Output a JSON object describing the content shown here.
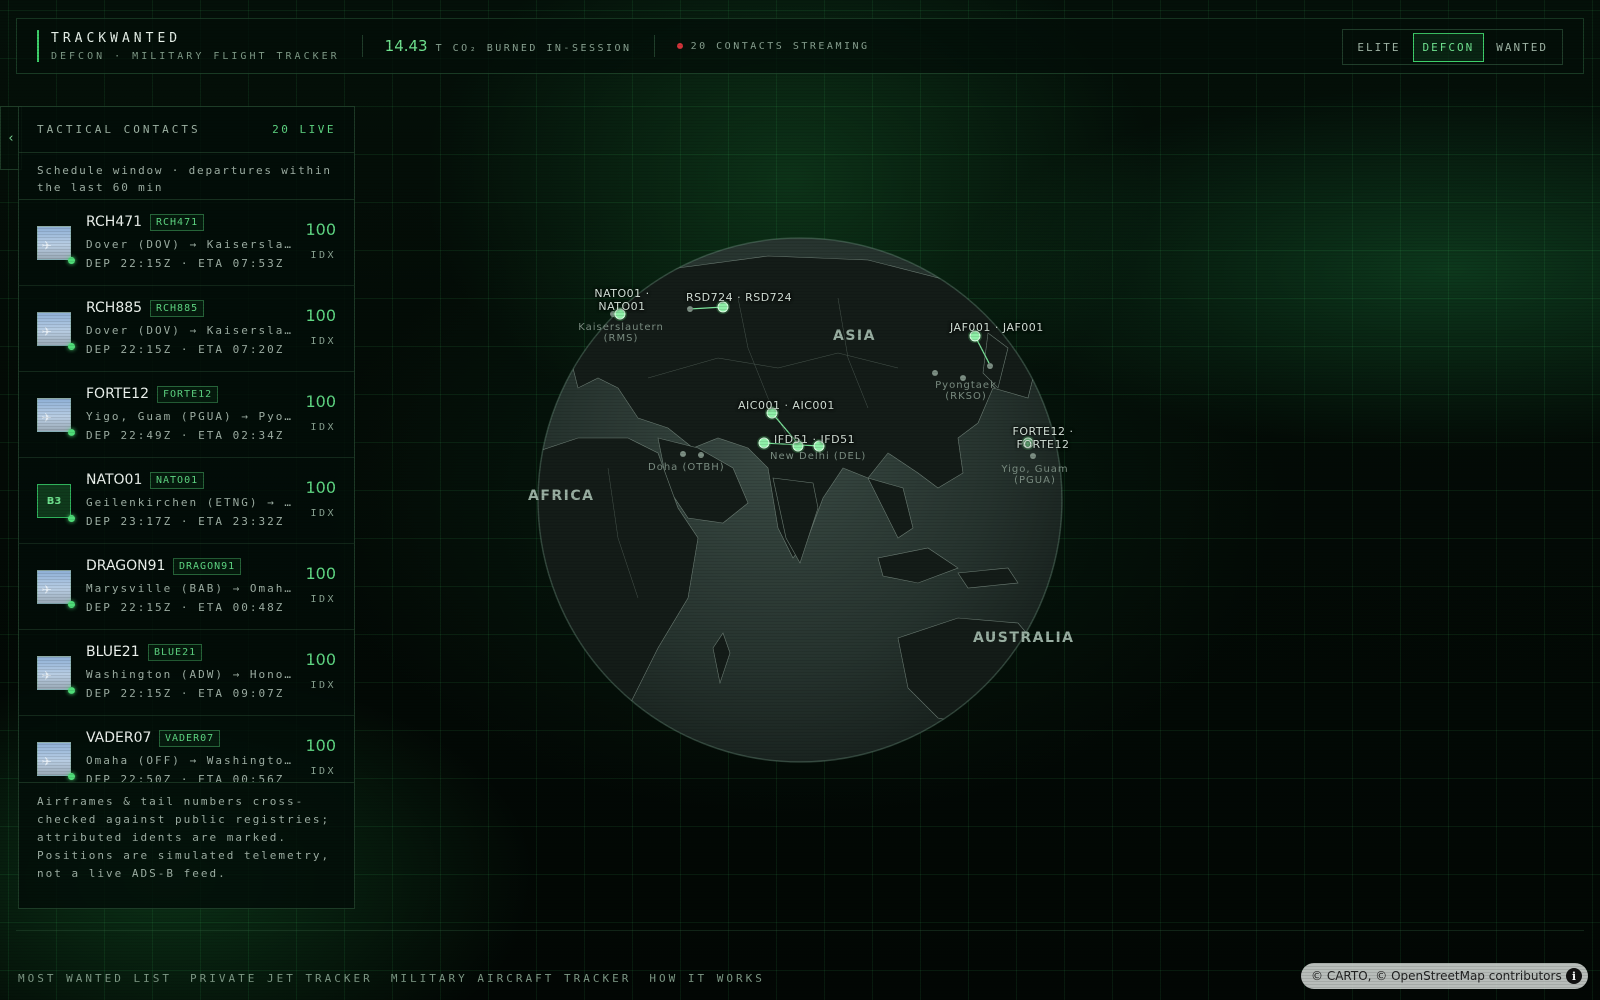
{
  "header": {
    "brand_title": "TRACKWANTED",
    "brand_subtitle": "DEFCON · MILITARY FLIGHT TRACKER",
    "co2_value": "14.43",
    "co2_label": "T CO₂ BURNED IN-SESSION",
    "contacts_label": "20 CONTACTS STREAMING",
    "modes": [
      "ELITE",
      "DEFCON",
      "WANTED"
    ],
    "active_mode": "DEFCON"
  },
  "colors": {
    "accent": "#3ecf6a",
    "live": "#4fdc78",
    "alert": "#d3343a",
    "background": "#020805"
  },
  "sidebar": {
    "collapse_icon": "chevron-left-icon",
    "title": "TACTICAL CONTACTS",
    "live_count": "20 LIVE",
    "window_note": "Schedule window · departures within the last 60 min",
    "items": [
      {
        "callsign": "RCH471",
        "tag": "RCH471",
        "route": "Dover (DOV) → Kaiserslautern (RMS)",
        "times": "DEP 22:15Z · ETA 07:53Z",
        "score": "100",
        "score_label": "IDX",
        "thumb": "photo"
      },
      {
        "callsign": "RCH885",
        "tag": "RCH885",
        "route": "Dover (DOV) → Kaiserslautern (RMS)",
        "times": "DEP 22:15Z · ETA 07:20Z",
        "score": "100",
        "score_label": "IDX",
        "thumb": "photo"
      },
      {
        "callsign": "FORTE12",
        "tag": "FORTE12",
        "route": "Yigo, Guam (PGUA) → Pyongtaek (RKSO)",
        "times": "DEP 22:49Z · ETA 02:34Z",
        "score": "100",
        "score_label": "IDX",
        "thumb": "photo"
      },
      {
        "callsign": "NATO01",
        "tag": "NATO01",
        "route": "Geilenkirchen (ETNG) → Kaiserslautern (RMS)",
        "times": "DEP 23:17Z · ETA 23:32Z",
        "score": "100",
        "score_label": "IDX",
        "thumb": "B3"
      },
      {
        "callsign": "DRAGON91",
        "tag": "DRAGON91",
        "route": "Marysville (BAB) → Omaha (OFF)",
        "times": "DEP 22:15Z · ETA 00:48Z",
        "score": "100",
        "score_label": "IDX",
        "thumb": "photo"
      },
      {
        "callsign": "BLUE21",
        "tag": "BLUE21",
        "route": "Washington (ADW) → Honolulu (HIK)",
        "times": "DEP 22:15Z · ETA 09:07Z",
        "score": "100",
        "score_label": "IDX",
        "thumb": "photo"
      },
      {
        "callsign": "VADER07",
        "tag": "VADER07",
        "route": "Omaha (OFF) → Washington (ADW)",
        "times": "DEP 22:50Z · ETA 00:56Z",
        "score": "100",
        "score_label": "IDX",
        "thumb": "photo"
      }
    ],
    "footer_note": "Airframes & tail numbers cross-checked against public registries; attributed idents are marked. Positions are simulated telemetry, not a live ADS-B feed."
  },
  "map": {
    "regions": [
      "ASIA",
      "AFRICA",
      "AUSTRALIA"
    ],
    "flight_labels": [
      "NATO01 · NATO01",
      "RSD724 · RSD724",
      "JAF001 · JAF001",
      "AIC001 · AIC001",
      "IFD51 · IFD51",
      "FORTE12 · FORTE12"
    ],
    "airport_labels": [
      "Kaiserslautern (RMS)",
      "Pyongtaek (RKSO)",
      "Doha (OTBH)",
      "New Delhi (DEL)",
      "Yigo, Guam (PGUA)"
    ]
  },
  "footer": {
    "nav": [
      "MOST WANTED LIST",
      "PRIVATE JET TRACKER",
      "MILITARY AIRCRAFT TRACKER",
      "HOW IT WORKS"
    ],
    "attribution": "© CARTO, © OpenStreetMap contributors",
    "info_icon": "info-icon"
  }
}
